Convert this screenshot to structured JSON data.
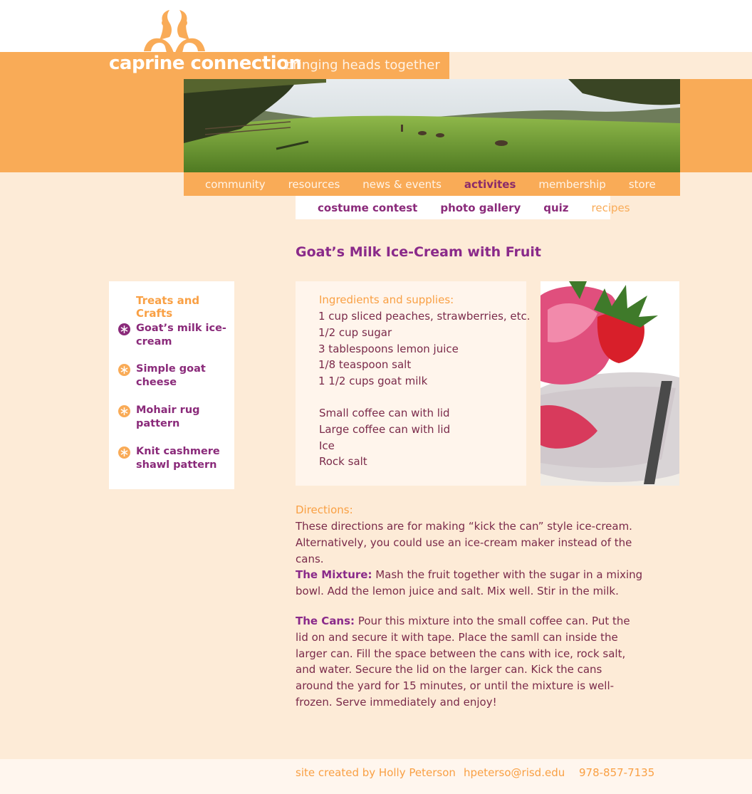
{
  "header": {
    "site_name": "caprine connection",
    "tagline": "bringing heads together"
  },
  "main_nav": [
    {
      "label": "community",
      "active": false
    },
    {
      "label": "resources",
      "active": false
    },
    {
      "label": "news & events",
      "active": false
    },
    {
      "label": "activites",
      "active": true
    },
    {
      "label": "membership",
      "active": false
    },
    {
      "label": "store",
      "active": false
    }
  ],
  "sub_nav": [
    {
      "label": "costume contest",
      "active": false
    },
    {
      "label": "photo gallery",
      "active": false
    },
    {
      "label": "quiz",
      "active": false
    },
    {
      "label": "recipes",
      "active": true
    }
  ],
  "page": {
    "title": "Goat’s Milk Ice-Cream with Fruit"
  },
  "sidebar": {
    "heading": "Treats and Crafts",
    "items": [
      {
        "label": "Goat’s milk ice-cream",
        "active": true
      },
      {
        "label": "Simple goat cheese",
        "active": false
      },
      {
        "label": "Mohair rug pattern",
        "active": false
      },
      {
        "label": "Knit cashmere shawl pattern",
        "active": false
      }
    ]
  },
  "ingredients": {
    "heading": "Ingredients and supplies:",
    "items": [
      "1 cup sliced peaches, strawberries, etc.",
      "1/2 cup sugar",
      "3 tablespoons lemon juice",
      "1/8 teaspoon salt",
      "1 1/2 cups goat milk"
    ],
    "supplies": [
      "Small coffee can with lid",
      "Large coffee can with lid",
      "Ice",
      "Rock salt"
    ]
  },
  "directions": {
    "heading": "Directions:",
    "intro": "These directions are for making “kick the can” style ice-cream. Alternatively, you could use an ice-cream maker instead of the cans.",
    "mixture_lead": "The Mixture:",
    "mixture_text": " Mash the fruit together with the sugar in a mixing bowl. Add the lemon juice and salt. Mix well. Stir in the milk.",
    "cans_lead": "The Cans:",
    "cans_text": " Pour this mixture into the small coffee can. Put the lid on and secure it with tape. Place the samll can inside the larger can. Fill the space between the cans with ice, rock salt, and water. Secure the lid on the larger can. Kick the cans around the yard for 15 minutes, or until the mixture is well-frozen. Serve immediately and enjoy!"
  },
  "footer": {
    "credit": "site created by Holly Peterson",
    "email": "hpeterso@risd.edu",
    "phone": "978-857-7135"
  },
  "colors": {
    "orange": "#f9ab57",
    "cream": "#fdebd7",
    "purple": "#8a2a7a",
    "text": "#7a2a4a"
  }
}
